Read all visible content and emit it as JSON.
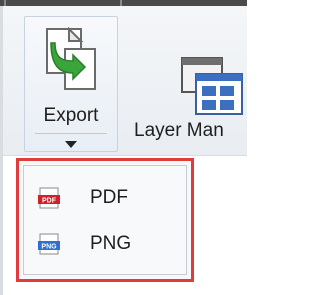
{
  "ribbon": {
    "export": {
      "label": "Export",
      "icon": "export-icon"
    },
    "layer_manager": {
      "label": "Layer Man",
      "icon": "layer-manager-icon"
    }
  },
  "menu": {
    "items": [
      {
        "label": "PDF",
        "icon": "pdf-icon",
        "badge": "PDF"
      },
      {
        "label": "PNG",
        "icon": "png-icon",
        "badge": "PNG"
      }
    ]
  },
  "colors": {
    "highlight_border": "#e03c3c",
    "pdf_badge": "#d0202a",
    "png_badge": "#2f6fd0",
    "export_arrow": "#3aa53a"
  }
}
